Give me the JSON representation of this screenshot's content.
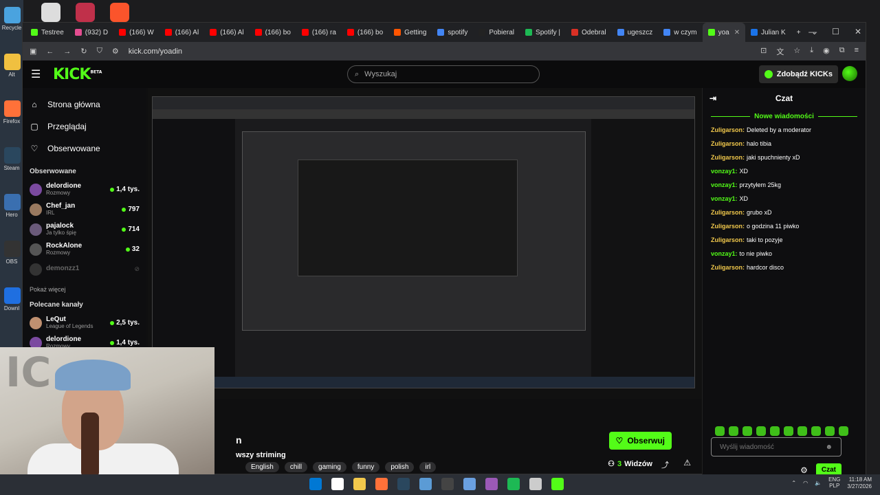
{
  "desktop": {
    "icons": [
      {
        "label": "Recycle",
        "color": "#4aa3df"
      },
      {
        "label": "Alt",
        "color": "#f0c040"
      },
      {
        "label": "Firefox",
        "color": "#ff7139"
      },
      {
        "label": "Steam",
        "color": "#2a475e"
      },
      {
        "label": "Hero",
        "color": "#3a6fb0"
      },
      {
        "label": "OBS",
        "color": "#333333"
      },
      {
        "label": "Downl",
        "color": "#1f6fe0"
      }
    ]
  },
  "browser": {
    "tabs": [
      {
        "label": "Testree",
        "color": "#53fc18"
      },
      {
        "label": "(932) D",
        "color": "#e44d90"
      },
      {
        "label": "(166) W",
        "color": "#ff0000"
      },
      {
        "label": "(166) Al",
        "color": "#ff0000"
      },
      {
        "label": "(166) Al",
        "color": "#ff0000"
      },
      {
        "label": "(166) bo",
        "color": "#ff0000"
      },
      {
        "label": "(166) ra",
        "color": "#ff0000"
      },
      {
        "label": "(166) bo",
        "color": "#ff0000"
      },
      {
        "label": "Getting",
        "color": "#ff5500"
      },
      {
        "label": "spotify",
        "color": "#4285f4"
      },
      {
        "label": "Pobieral",
        "color": "#222222"
      },
      {
        "label": "Spotify |",
        "color": "#1db954"
      },
      {
        "label": "Odebral",
        "color": "#d93025"
      },
      {
        "label": "ugeszcz",
        "color": "#4285f4"
      },
      {
        "label": "w czym",
        "color": "#4285f4"
      },
      {
        "label": "yoa",
        "color": "#53fc18",
        "active": true
      },
      {
        "label": "Julian K",
        "color": "#1a73e8"
      }
    ],
    "new_tab": "+",
    "tab_list": "⌄",
    "window_controls": {
      "minimize": "—",
      "maximize": "☐",
      "close": "✕"
    },
    "url": "kick.com/yoadin"
  },
  "kick": {
    "logo": "KICK",
    "logo_badge": "BETA",
    "search_placeholder": "Wyszukaj",
    "kicks_button": "Zdobądź KICKs",
    "nav": [
      {
        "label": "Strona główna",
        "icon": "home-icon",
        "glyph": "⌂"
      },
      {
        "label": "Przeglądaj",
        "icon": "browse-icon",
        "glyph": "▢"
      },
      {
        "label": "Obserwowane",
        "icon": "heart-icon",
        "glyph": "♡"
      }
    ],
    "followed_title": "Obserwowane",
    "followed": [
      {
        "name": "delordione",
        "sub": "Rozmowy",
        "count": "1,4 tys.",
        "color": "#7b4aa0",
        "online": true
      },
      {
        "name": "Chef_jan",
        "sub": "IRL",
        "count": "797",
        "color": "#9a7a60",
        "online": true
      },
      {
        "name": "pajalock",
        "sub": "Ja tylko śpię",
        "count": "714",
        "color": "#6a5a7a",
        "online": true
      },
      {
        "name": "RockAlone",
        "sub": "Rozmowy",
        "count": "32",
        "color": "#555555",
        "online": true
      },
      {
        "name": "demonzz1",
        "sub": "",
        "count": "",
        "color": "#333333",
        "online": false
      }
    ],
    "show_more": "Pokaż więcej",
    "recommended_title": "Polecane kanały",
    "recommended": [
      {
        "name": "LeQut",
        "sub": "League of Legends",
        "count": "2,5 tys.",
        "color": "#c09070",
        "online": true
      },
      {
        "name": "delordione",
        "sub": "Rozmowy",
        "count": "1,4 tys.",
        "color": "#7b4aa0",
        "online": true
      }
    ],
    "stream": {
      "title_fragment": "n",
      "category_fragment": "wszy striming",
      "tags": [
        "English",
        "chill",
        "gaming",
        "funny",
        "polish",
        "irl"
      ],
      "follow_label": "Obserwuj",
      "viewers_count": "3",
      "viewers_label": "Widzów"
    },
    "chat": {
      "title": "Czat",
      "new_messages": "Nowe wiadomości",
      "messages": [
        {
          "user": "Zuligarson:",
          "text": "Deleted by a moderator",
          "color": "yellow"
        },
        {
          "user": "Zuligarson:",
          "text": "halo tibia",
          "color": "yellow"
        },
        {
          "user": "Zuligarson:",
          "text": "jaki spuchnienty xD",
          "color": "yellow"
        },
        {
          "user": "vonzay1:",
          "text": "XD",
          "color": "green"
        },
        {
          "user": "vonzay1:",
          "text": "przytyłem 25kg",
          "color": "green"
        },
        {
          "user": "vonzay1:",
          "text": "XD",
          "color": "green"
        },
        {
          "user": "Zuligarson:",
          "text": "grubo xD",
          "color": "yellow"
        },
        {
          "user": "Zuligarson:",
          "text": "o godzina 11 piwko",
          "color": "yellow"
        },
        {
          "user": "Zuligarson:",
          "text": "taki to pozyje",
          "color": "yellow"
        },
        {
          "user": "vonzay1:",
          "text": "to nie piwko",
          "color": "green"
        },
        {
          "user": "Zuligarson:",
          "text": "hardcor disco",
          "color": "yellow"
        }
      ],
      "input_placeholder": "Wyślij wiadomość",
      "send_label": "Czat"
    }
  },
  "taskbar": {
    "lang_top": "ENG",
    "lang_bottom": "PLP",
    "time": "11:18 AM",
    "date": "3/27/2026"
  },
  "colors": {
    "accent": "#53fc18"
  }
}
